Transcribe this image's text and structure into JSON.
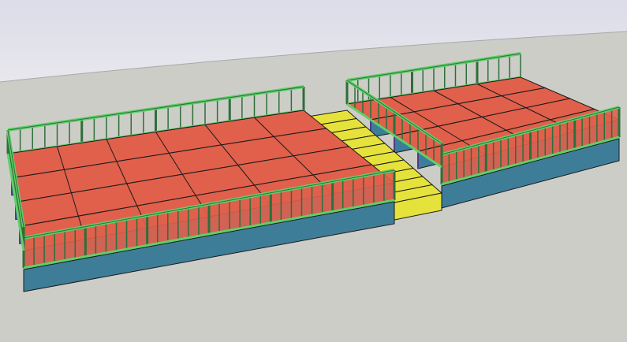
{
  "scene": {
    "colors": {
      "sky_top": "#dcdcea",
      "sky_bottom": "#e8e8ec",
      "ground": "#cdcdc8",
      "horizon": "#a8a8a8",
      "deck": "#e0604c",
      "fascia": "#3e7d98",
      "rail": "#5fcf6a",
      "rail_dark": "#2e6e3a",
      "stairs": "#e6e23c",
      "frame": "#4a3c8c",
      "edge": "#1a1a1a"
    },
    "left_block_tiers": 4,
    "right_block_tiers": 4,
    "stair_steps": 10
  }
}
